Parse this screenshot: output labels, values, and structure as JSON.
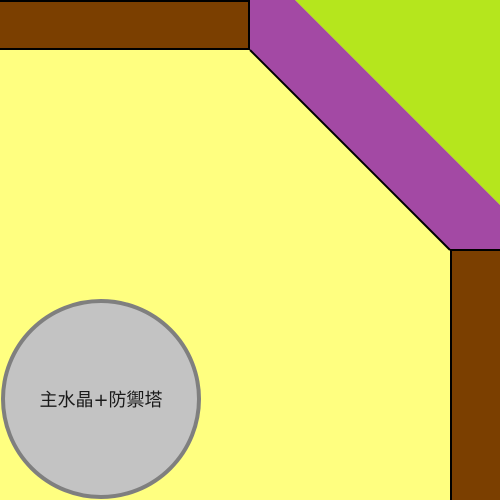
{
  "map": {
    "ground_color": "#ffff80",
    "wall_color": "#7b3f00",
    "road_color": "#a349a4",
    "enemy_zone_color": "#b5e61d",
    "core_color": "#c3c3c3",
    "core_border_color": "#7f7f7f"
  },
  "base": {
    "label": "主水晶+防禦塔"
  }
}
